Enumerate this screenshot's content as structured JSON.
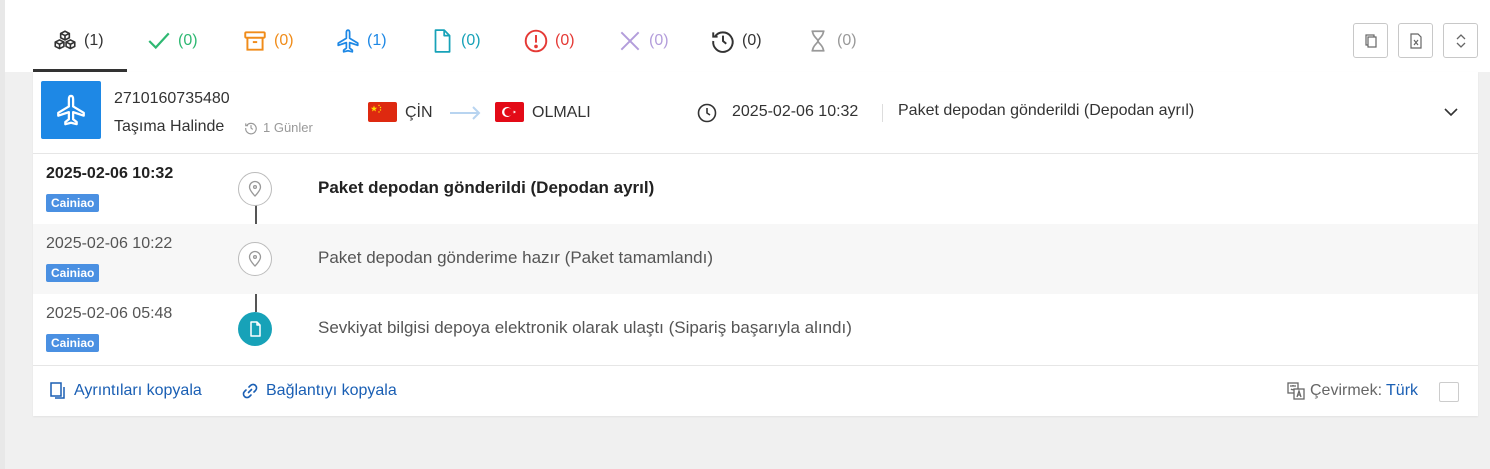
{
  "tabs": [
    {
      "name": "all",
      "count": "(1)",
      "color": "#333333",
      "icon": "boxes-icon"
    },
    {
      "name": "delivered",
      "count": "(0)",
      "color": "#2eb872",
      "icon": "check-icon"
    },
    {
      "name": "pickup",
      "count": "(0)",
      "color": "#f08c1a",
      "icon": "package-icon"
    },
    {
      "name": "in-transit",
      "count": "(1)",
      "color": "#1e88e5",
      "icon": "plane-icon"
    },
    {
      "name": "info-received",
      "count": "(0)",
      "color": "#17a2b8",
      "icon": "document-icon"
    },
    {
      "name": "alert",
      "count": "(0)",
      "color": "#e53935",
      "icon": "alert-icon"
    },
    {
      "name": "undelivered",
      "count": "(0)",
      "color": "#b39ddb",
      "icon": "x-icon"
    },
    {
      "name": "expired",
      "count": "(0)",
      "color": "#333333",
      "icon": "history-icon"
    },
    {
      "name": "not-found",
      "count": "(0)",
      "color": "#999999",
      "icon": "hourglass-icon"
    }
  ],
  "toolbar": {
    "copy_icon": "copy-icon",
    "excel_icon": "excel-icon",
    "expand_icon": "expand-collapse-icon"
  },
  "shipment": {
    "tracking_number": "2710160735480",
    "status": "Taşıma Halinde",
    "days": "1 Günler",
    "origin": "ÇİN",
    "destination": "OLMALI",
    "latest_time": "2025-02-06 10:32",
    "latest_description": "Paket depodan gönderildi (Depodan ayrıl)"
  },
  "events": [
    {
      "time": "2025-02-06 10:32",
      "carrier": "Cainiao",
      "description": "Paket depodan gönderildi (Depodan ayrıl)"
    },
    {
      "time": "2025-02-06 10:22",
      "carrier": "Cainiao",
      "description": "Paket depodan gönderime hazır (Paket tamamlandı)"
    },
    {
      "time": "2025-02-06 05:48",
      "carrier": "Cainiao",
      "description": "Sevkiyat bilgisi depoya elektronik olarak ulaştı (Sipariş başarıyla alındı)"
    }
  ],
  "footer": {
    "copy_details": "Ayrıntıları kopyala",
    "copy_link": "Bağlantıyı kopyala",
    "translate_label": "Çevirmek:",
    "translate_lang": "Türk"
  }
}
